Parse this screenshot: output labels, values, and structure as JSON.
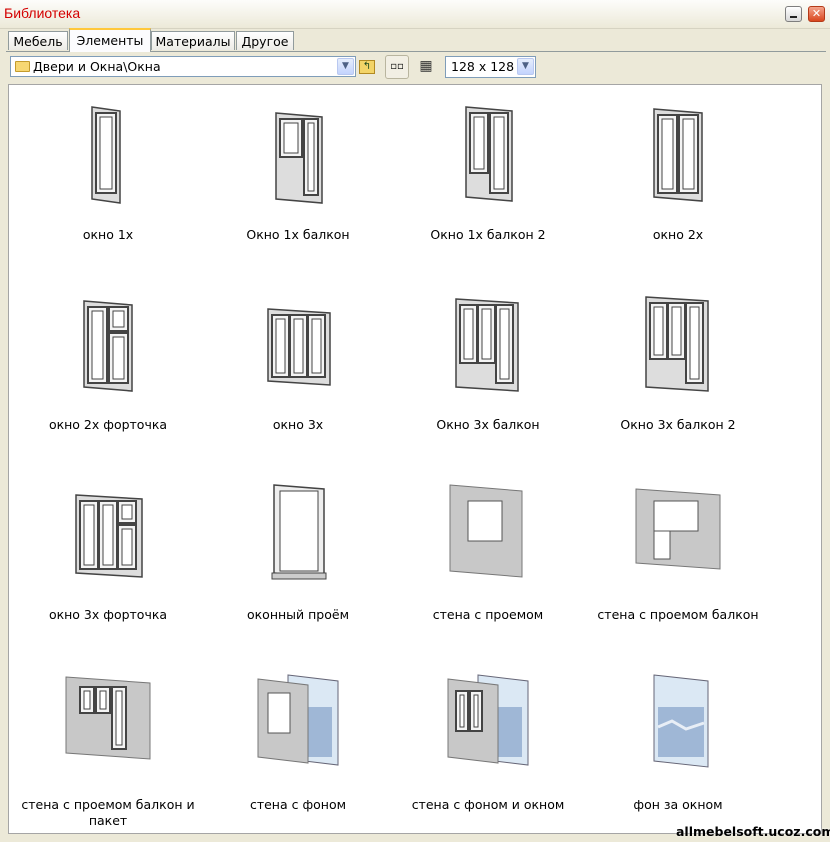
{
  "window": {
    "title": "Библиотека"
  },
  "tabs": [
    "Мебель",
    "Элементы",
    "Материалы",
    "Другое"
  ],
  "active_tab": "Элементы",
  "toolbar": {
    "path": "Двери и Окна\\Окна",
    "size": "128 x 128"
  },
  "items": [
    {
      "label": "окно 1х",
      "icon": "window-1-sash-icon"
    },
    {
      "label": "Окно 1х балкон",
      "icon": "window-balcony-icon"
    },
    {
      "label": "Окно 1х балкон 2",
      "icon": "window-balcony-2-icon"
    },
    {
      "label": "окно 2х",
      "icon": "window-2-sash-icon"
    },
    {
      "label": "окно 2х форточка",
      "icon": "window-2-vent-icon"
    },
    {
      "label": "окно 3х",
      "icon": "window-3-sash-icon"
    },
    {
      "label": "Окно 3х балкон",
      "icon": "window-3-balcony-icon"
    },
    {
      "label": "Окно 3х балкон 2",
      "icon": "window-3-balcony-2-icon"
    },
    {
      "label": "окно 3х форточка",
      "icon": "window-3-vent-icon"
    },
    {
      "label": "оконный проём",
      "icon": "window-opening-icon"
    },
    {
      "label": "стена с проемом",
      "icon": "wall-opening-icon"
    },
    {
      "label": "стена с проемом балкон",
      "icon": "wall-balcony-opening-icon"
    },
    {
      "label": "стена с проемом балкон и пакет",
      "icon": "wall-balcony-window-icon"
    },
    {
      "label": "стена с фоном",
      "icon": "wall-background-icon"
    },
    {
      "label": "стена с фоном и окном",
      "icon": "wall-background-window-icon"
    },
    {
      "label": "фон за окном",
      "icon": "background-photo-icon"
    }
  ],
  "watermark": "allmebelsoft.ucoz.com"
}
